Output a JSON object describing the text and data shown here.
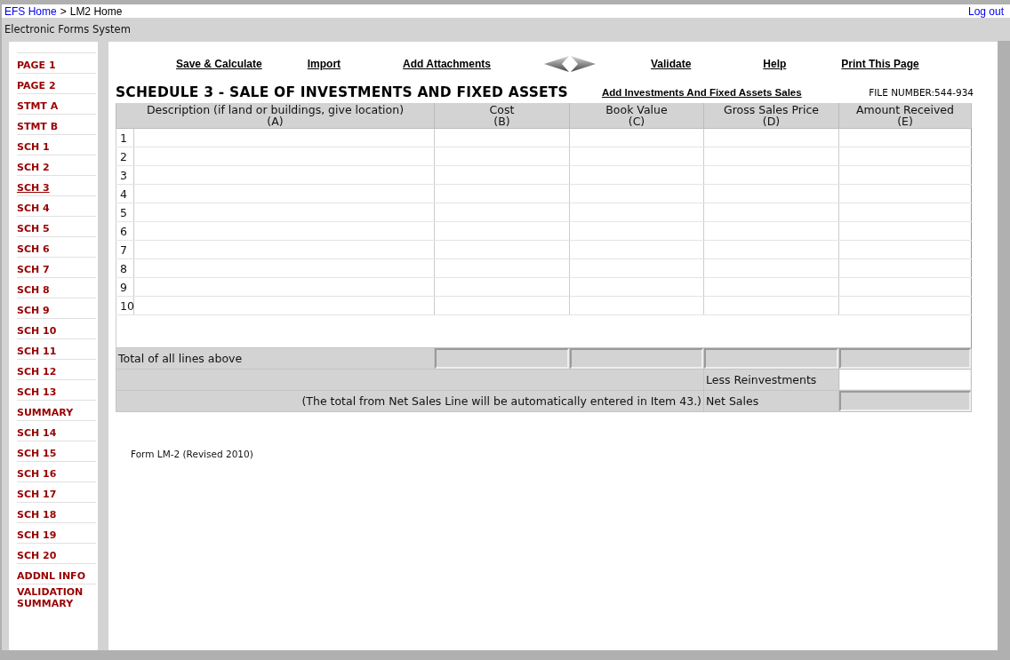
{
  "breadcrumb": {
    "home_link": "EFS Home",
    "separator": ">",
    "current": "LM2 Home"
  },
  "logout": "Log out",
  "app_title": "Electronic Forms System",
  "sidebar": {
    "items": [
      {
        "label": "PAGE 1",
        "selected": false
      },
      {
        "label": "PAGE 2",
        "selected": false
      },
      {
        "label": "STMT A",
        "selected": false
      },
      {
        "label": "STMT B",
        "selected": false
      },
      {
        "label": "SCH 1",
        "selected": false
      },
      {
        "label": "SCH 2",
        "selected": false
      },
      {
        "label": "SCH 3",
        "selected": true
      },
      {
        "label": "SCH 4",
        "selected": false
      },
      {
        "label": "SCH 5",
        "selected": false
      },
      {
        "label": "SCH 6",
        "selected": false
      },
      {
        "label": "SCH 7",
        "selected": false
      },
      {
        "label": "SCH 8",
        "selected": false
      },
      {
        "label": "SCH 9",
        "selected": false
      },
      {
        "label": "SCH 10",
        "selected": false
      },
      {
        "label": "SCH 11",
        "selected": false
      },
      {
        "label": "SCH 12",
        "selected": false
      },
      {
        "label": "SCH 13",
        "selected": false
      },
      {
        "label": "SUMMARY",
        "selected": false
      },
      {
        "label": "SCH 14",
        "selected": false
      },
      {
        "label": "SCH 15",
        "selected": false
      },
      {
        "label": "SCH 16",
        "selected": false
      },
      {
        "label": "SCH 17",
        "selected": false
      },
      {
        "label": "SCH 18",
        "selected": false
      },
      {
        "label": "SCH 19",
        "selected": false
      },
      {
        "label": "SCH 20",
        "selected": false
      },
      {
        "label": "ADDNL INFO",
        "selected": false
      },
      {
        "label": "VALIDATION SUMMARY",
        "selected": false
      }
    ]
  },
  "toolbar": {
    "left": [
      "Save & Calculate",
      "Import",
      "Add Attachments"
    ],
    "right": [
      "Validate",
      "Help",
      "Print This Page"
    ]
  },
  "heading": "SCHEDULE 3 - SALE OF INVESTMENTS AND FIXED ASSETS",
  "add_link": "Add Investments And Fixed Assets Sales",
  "file_number": "FILE NUMBER:544-934",
  "table": {
    "columns": [
      {
        "label": "Description (if land or buildings, give location)",
        "letter": "(A)"
      },
      {
        "label": "Cost",
        "letter": "(B)"
      },
      {
        "label": "Book Value",
        "letter": "(C)"
      },
      {
        "label": "Gross Sales Price",
        "letter": "(D)"
      },
      {
        "label": "Amount Received",
        "letter": "(E)"
      }
    ],
    "rows": [
      "1",
      "2",
      "3",
      "4",
      "5",
      "6",
      "7",
      "8",
      "9",
      "10"
    ]
  },
  "totals": {
    "label": "Total of all lines above",
    "fields": [
      {
        "disabled": true
      },
      {
        "disabled": true
      },
      {
        "disabled": true
      },
      {
        "disabled": true
      }
    ]
  },
  "reinvestments": {
    "label": "Less Reinvestments",
    "disabled": false
  },
  "net_sales": {
    "note": "(The total from Net Sales Line will be automatically entered in Item 43.)",
    "label": "Net Sales",
    "disabled": true
  },
  "footer": "Form LM-2 (Revised 2010)"
}
